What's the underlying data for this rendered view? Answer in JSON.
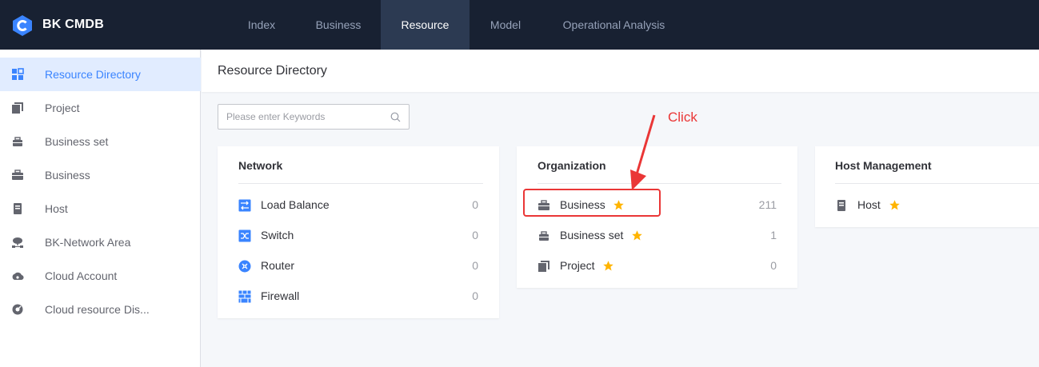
{
  "app": {
    "brand": "BK CMDB"
  },
  "nav": [
    {
      "label": "Index",
      "active": false
    },
    {
      "label": "Business",
      "active": false
    },
    {
      "label": "Resource",
      "active": true
    },
    {
      "label": "Model",
      "active": false
    },
    {
      "label": "Operational Analysis",
      "active": false
    }
  ],
  "sidebar": {
    "items": [
      {
        "label": "Resource Directory",
        "icon": "grid-icon",
        "active": true
      },
      {
        "label": "Project",
        "icon": "project-icon"
      },
      {
        "label": "Business set",
        "icon": "business-set-icon"
      },
      {
        "label": "Business",
        "icon": "briefcase-icon"
      },
      {
        "label": "Host",
        "icon": "host-icon"
      },
      {
        "label": "BK-Network Area",
        "icon": "network-area-icon"
      },
      {
        "label": "Cloud Account",
        "icon": "cloud-account-icon"
      },
      {
        "label": "Cloud resource Dis...",
        "icon": "cloud-discovery-icon"
      }
    ]
  },
  "page": {
    "title": "Resource Directory"
  },
  "search": {
    "placeholder": "Please enter Keywords",
    "value": ""
  },
  "cards": {
    "network": {
      "title": "Network",
      "rows": [
        {
          "label": "Load Balance",
          "count": "0",
          "icon": "load-balance-icon"
        },
        {
          "label": "Switch",
          "count": "0",
          "icon": "switch-icon"
        },
        {
          "label": "Router",
          "count": "0",
          "icon": "router-icon"
        },
        {
          "label": "Firewall",
          "count": "0",
          "icon": "firewall-icon"
        }
      ]
    },
    "organization": {
      "title": "Organization",
      "rows": [
        {
          "label": "Business",
          "count": "211",
          "icon": "briefcase-icon",
          "starred": true
        },
        {
          "label": "Business set",
          "count": "1",
          "icon": "business-set-icon",
          "starred": true
        },
        {
          "label": "Project",
          "count": "0",
          "icon": "project-icon",
          "starred": true
        }
      ]
    },
    "host_management": {
      "title": "Host Management",
      "rows": [
        {
          "label": "Host",
          "icon": "host-icon",
          "starred": true
        }
      ]
    }
  },
  "annotation": {
    "text": "Click"
  },
  "colors": {
    "topbar": "#182132",
    "accent": "#3a84ff",
    "annotation": "#ea3636",
    "star": "#ffb400"
  }
}
